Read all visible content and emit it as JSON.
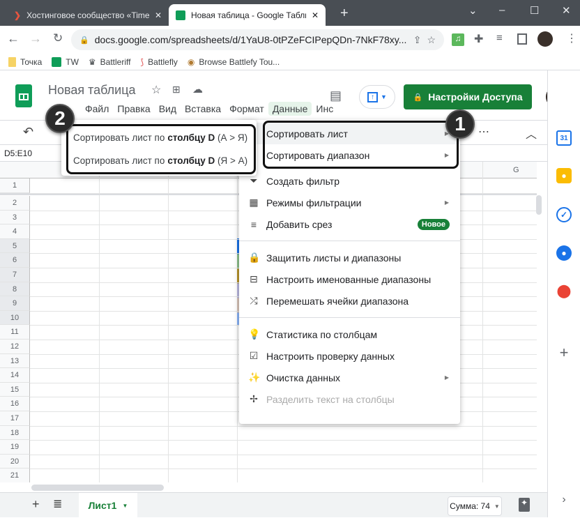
{
  "browser": {
    "tabs": [
      {
        "title": "Хостинговое сообщество «Time",
        "active": false
      },
      {
        "title": "Новая таблица - Google Таблиц",
        "active": true
      }
    ],
    "new_tab": "+",
    "url": "docs.google.com/spreadsheets/d/1YaU8-0tPZeFCIPepQDn-7NkF78xy...",
    "bookmarks": [
      "Точка",
      "TW",
      "Battleriff",
      "Battlefly",
      "Browse Battlefy Tou..."
    ]
  },
  "sheets": {
    "title": "Новая таблица",
    "menu": [
      "Файл",
      "Правка",
      "Вид",
      "Вставка",
      "Формат",
      "Данные",
      "Инс"
    ],
    "share_label": "Настройки Доступа",
    "cell_ref": "D5:E10",
    "column_g": "G",
    "rows": [
      "1",
      "2",
      "3",
      "4",
      "5",
      "6",
      "7",
      "8",
      "9",
      "10",
      "11",
      "12",
      "13",
      "14",
      "15",
      "16",
      "17",
      "18",
      "19",
      "20",
      "21"
    ],
    "sheet_tab": "Лист1",
    "sum_label": "Сумма: 74",
    "accent": "#188038"
  },
  "data_menu": {
    "items": [
      {
        "label": "Сортировать лист",
        "icon": "none",
        "submenu": true
      },
      {
        "label": "Сортировать диапазон",
        "icon": "none",
        "submenu": true
      },
      {
        "label": "Создать фильтр",
        "icon": "filter-icon"
      },
      {
        "label": "Режимы фильтрации",
        "icon": "filter-views-icon",
        "submenu": true
      },
      {
        "label": "Добавить срез",
        "icon": "slicer-icon",
        "badge": "Новое"
      },
      {
        "label": "Защитить листы и диапазоны",
        "icon": "lock-icon"
      },
      {
        "label": "Настроить именованные диапазоны",
        "icon": "named-ranges-icon"
      },
      {
        "label": "Перемешать ячейки диапазона",
        "icon": "shuffle-icon"
      },
      {
        "label": "Статистика по столбцам",
        "icon": "lightbulb-icon"
      },
      {
        "label": "Настроить проверку данных",
        "icon": "data-validation-icon"
      },
      {
        "label": "Очистка данных",
        "icon": "magic-wand-icon",
        "submenu": true
      },
      {
        "label": "Разделить текст на столбцы",
        "icon": "split-icon",
        "disabled": true
      }
    ]
  },
  "sort_submenu": {
    "items": [
      {
        "prefix": "Сортировать лист по ",
        "bold": "столбцу D",
        "suffix": " (А > Я)"
      },
      {
        "prefix": "Сортировать лист по ",
        "bold": "столбцу D",
        "suffix": " (Я > А)"
      }
    ]
  },
  "callouts": [
    "1",
    "2"
  ]
}
